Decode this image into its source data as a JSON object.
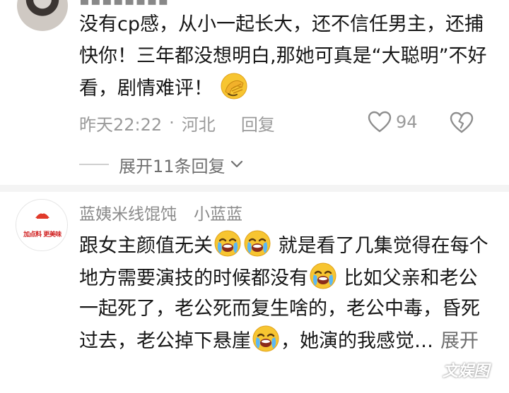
{
  "comment1": {
    "username_cutoff": "▪▪▪▪▪▪▪▪",
    "text_part1": "没有cp感，从小一起长大，还不信任男主，还捕快你！三年都没想明白,那她可真是“大聪明”不好看，剧情难评！",
    "emoji_facepalm": "facepalm-emoji",
    "date": "昨天22:22",
    "separator": "·",
    "location": "河北",
    "reply_label": "回复",
    "like_count": "94",
    "expand_label": "展开11条回复"
  },
  "comment2": {
    "username": "蓝姨米线馄饨",
    "user_tag": "小蓝蓝",
    "avatar_text": "加点料 更美味",
    "seg1": "跟女主颜值无关",
    "seg2": " 就是看了几集觉得在每个地方需要演技的时候都没有",
    "seg3": " 比如父亲和老公一起死了，老公死而复生啥的，老公中毒，昏死过去，老公掉下悬崖",
    "seg4": "，她演的我感觉…",
    "more_label": "展开"
  },
  "watermark": "文娱图",
  "colors": {
    "text_primary": "#161616",
    "text_meta": "#9a9a9a",
    "divider": "#f4f4f4",
    "emoji_yellow": "#f7c531",
    "brand_red": "#d02020"
  }
}
